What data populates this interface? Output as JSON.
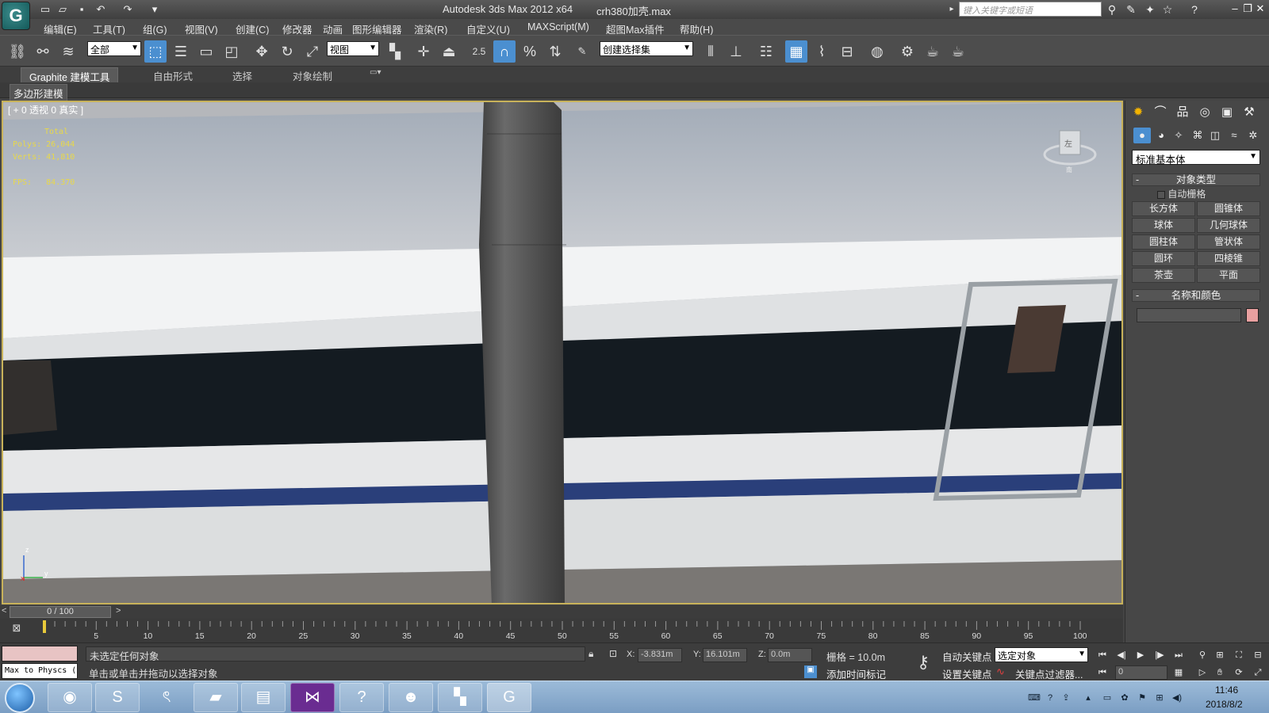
{
  "titlebar": {
    "app_name": "Autodesk 3ds Max  2012 x64",
    "file_name": "crh380加壳.max",
    "search_placeholder": "键入关键字或短语",
    "logo_icon": "3ds-max-logo-icon"
  },
  "menu": [
    "编辑(E)",
    "工具(T)",
    "组(G)",
    "视图(V)",
    "创建(C)",
    "修改器",
    "动画",
    "图形编辑器",
    "渲染(R)",
    "自定义(U)",
    "MAXScript(M)",
    "超图Max插件",
    "帮助(H)"
  ],
  "toolbar": {
    "selection_filter": "全部",
    "reference_coord": "视图",
    "snap_value": "2.5",
    "named_selection": "创建选择集"
  },
  "ribbon": {
    "tabs": [
      "Graphite 建模工具",
      "自由形式",
      "选择",
      "对象绘制"
    ],
    "sub_label": "多边形建模"
  },
  "viewport": {
    "label": "[ + 0 透视 0 真实 ]",
    "stats": {
      "total_label": "Total",
      "polys_label": "Polys:",
      "polys_value": "26,044",
      "verts_label": "Verts:",
      "verts_value": "41,810",
      "fps_label": "FPS:",
      "fps_value": "84.370"
    },
    "axis_z": "z",
    "axis_y": "y",
    "axis_x": "x",
    "cube_label": "左",
    "cube_south": "南"
  },
  "command_panel": {
    "category": "标准基本体",
    "rollout_object_type": "对象类型",
    "auto_grid": "自动栅格",
    "object_buttons": [
      "长方体",
      "圆锥体",
      "球体",
      "几何球体",
      "圆柱体",
      "管状体",
      "圆环",
      "四棱锥",
      "茶壶",
      "平面"
    ],
    "rollout_name_color": "名称和颜色",
    "object_color": "#e8a0a0"
  },
  "timeline": {
    "frame_display": "0 / 100",
    "ticks": [
      "5",
      "10",
      "15",
      "20",
      "25",
      "30",
      "35",
      "40",
      "45",
      "50",
      "55",
      "60",
      "65",
      "70",
      "75",
      "80",
      "85",
      "90",
      "95",
      "100"
    ]
  },
  "status": {
    "maxscript_listener": "Max to Physcs (",
    "selection_status": "未选定任何对象",
    "prompt": "单击或单击并拖动以选择对象",
    "x_label": "X:",
    "x_value": "-3.831m",
    "y_label": "Y:",
    "y_value": "16.101m",
    "z_label": "Z:",
    "z_value": "0.0m",
    "grid": "栅格 = 10.0m",
    "add_time_tag": "添加时间标记",
    "auto_key": "自动关键点",
    "set_key": "设置关键点",
    "key_mode": "选定对象",
    "key_filters": "关键点过滤器...",
    "current_frame": "0"
  },
  "taskbar": {
    "time": "11:46",
    "date": "2018/8/2"
  }
}
